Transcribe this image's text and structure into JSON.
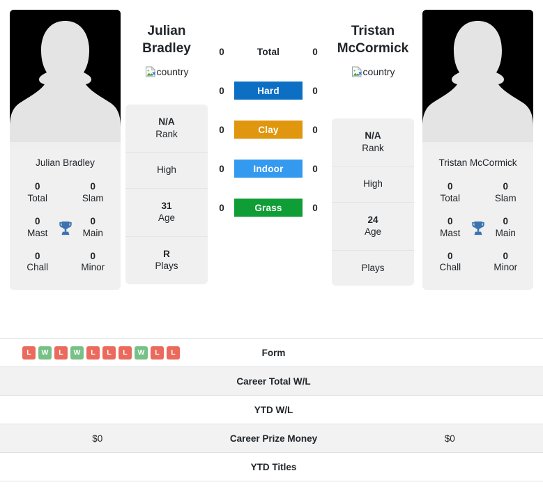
{
  "players": {
    "left": {
      "first_name": "Julian",
      "last_name": "Bradley",
      "full_name": "Julian Bradley",
      "country_alt": "country",
      "titles": [
        {
          "value": "0",
          "label": "Total"
        },
        {
          "value": "0",
          "label": "Slam"
        },
        {
          "value": "0",
          "label": "Mast"
        },
        {
          "value": "0",
          "label": "Main"
        },
        {
          "value": "0",
          "label": "Chall"
        },
        {
          "value": "0",
          "label": "Minor"
        }
      ],
      "info": [
        {
          "value": "N/A",
          "label": "Rank"
        },
        {
          "value": "",
          "label": "High"
        },
        {
          "value": "31",
          "label": "Age"
        },
        {
          "value": "R",
          "label": "Plays"
        }
      ]
    },
    "right": {
      "first_name": "Tristan",
      "last_name": "McCormick",
      "full_name": "Tristan McCormick",
      "country_alt": "country",
      "titles": [
        {
          "value": "0",
          "label": "Total"
        },
        {
          "value": "0",
          "label": "Slam"
        },
        {
          "value": "0",
          "label": "Mast"
        },
        {
          "value": "0",
          "label": "Main"
        },
        {
          "value": "0",
          "label": "Chall"
        },
        {
          "value": "0",
          "label": "Minor"
        }
      ],
      "info": [
        {
          "value": "N/A",
          "label": "Rank"
        },
        {
          "value": "",
          "label": "High"
        },
        {
          "value": "24",
          "label": "Age"
        },
        {
          "value": "",
          "label": "Plays"
        }
      ]
    }
  },
  "surfaces": [
    {
      "label": "Total",
      "left": "0",
      "right": "0",
      "color": "transparent",
      "plain": true
    },
    {
      "label": "Hard",
      "left": "0",
      "right": "0",
      "color": "#0d6fc4",
      "plain": false
    },
    {
      "label": "Clay",
      "left": "0",
      "right": "0",
      "color": "#e0960d",
      "plain": false
    },
    {
      "label": "Indoor",
      "left": "0",
      "right": "0",
      "color": "#339af0",
      "plain": false
    },
    {
      "label": "Grass",
      "left": "0",
      "right": "0",
      "color": "#0f9d35",
      "plain": false
    }
  ],
  "table_rows": [
    {
      "label": "Form",
      "left": "",
      "right": "",
      "form": [
        "L",
        "W",
        "L",
        "W",
        "L",
        "L",
        "L",
        "W",
        "L",
        "L"
      ]
    },
    {
      "label": "Career Total W/L",
      "left": "",
      "right": "",
      "form": []
    },
    {
      "label": "YTD W/L",
      "left": "",
      "right": "",
      "form": []
    },
    {
      "label": "Career Prize Money",
      "left": "$0",
      "right": "$0",
      "form": []
    },
    {
      "label": "YTD Titles",
      "left": "",
      "right": "",
      "form": []
    }
  ],
  "colors": {
    "win": "#77c187",
    "loss": "#ea6a5d",
    "panel_bg": "#f0f0f0",
    "row_alt_bg": "#f2f2f2",
    "trophy": "#3c72b0"
  }
}
